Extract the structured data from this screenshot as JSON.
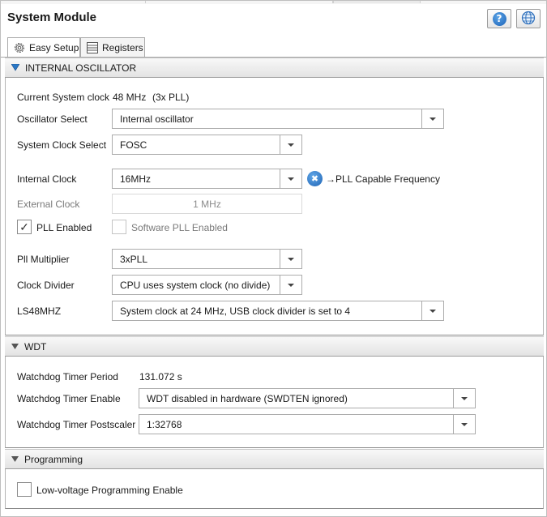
{
  "window": {
    "title": "System Module"
  },
  "toolbar": {
    "help_icon": "help-icon",
    "help_glyph": "?",
    "globe_icon": "globe-icon"
  },
  "tabs": [
    {
      "label": "Easy Setup",
      "icon": "gear-icon",
      "active": true
    },
    {
      "label": "Registers",
      "icon": "registers-icon",
      "active": false
    }
  ],
  "internal_oscillator": {
    "header": "INTERNAL OSCILLATOR",
    "current_clock": {
      "label": "Current System clock",
      "value": "48 MHz",
      "note": "(3x PLL)"
    },
    "oscillator_select": {
      "label": "Oscillator Select",
      "value": "Internal oscillator"
    },
    "system_clock_select": {
      "label": "System Clock Select",
      "value": "FOSC"
    },
    "internal_clock": {
      "label": "Internal Clock",
      "value": "16MHz",
      "hint": "→PLL Capable Frequency",
      "hint_icon": "x-circle-icon",
      "hint_glyph": "✖"
    },
    "external_clock": {
      "label": "External Clock",
      "value": "1 MHz"
    },
    "pll_enabled": {
      "label": "PLL Enabled",
      "checked": true,
      "check_glyph": "✓"
    },
    "software_pll": {
      "label": "Software PLL Enabled",
      "checked": false
    },
    "pll_multiplier": {
      "label": "Pll Multiplier",
      "value": "3xPLL"
    },
    "clock_divider": {
      "label": "Clock Divider",
      "value": "CPU uses system clock (no divide)"
    },
    "ls48mhz": {
      "label": "LS48MHZ",
      "value": "System clock at 24 MHz, USB clock divider is set to 4"
    }
  },
  "wdt": {
    "header": "WDT",
    "period": {
      "label": "Watchdog Timer Period",
      "value": "131.072 s"
    },
    "enable": {
      "label": "Watchdog Timer Enable",
      "value": "WDT disabled in hardware (SWDTEN ignored)"
    },
    "postscaler": {
      "label": "Watchdog Timer Postscaler",
      "value": "1:32768"
    }
  },
  "programming": {
    "header": "Programming",
    "lvp": {
      "label": "Low-voltage Programming Enable",
      "checked": false
    }
  },
  "colors": {
    "accent": "#1f64b5",
    "header_bg": "#e3e3e3"
  }
}
